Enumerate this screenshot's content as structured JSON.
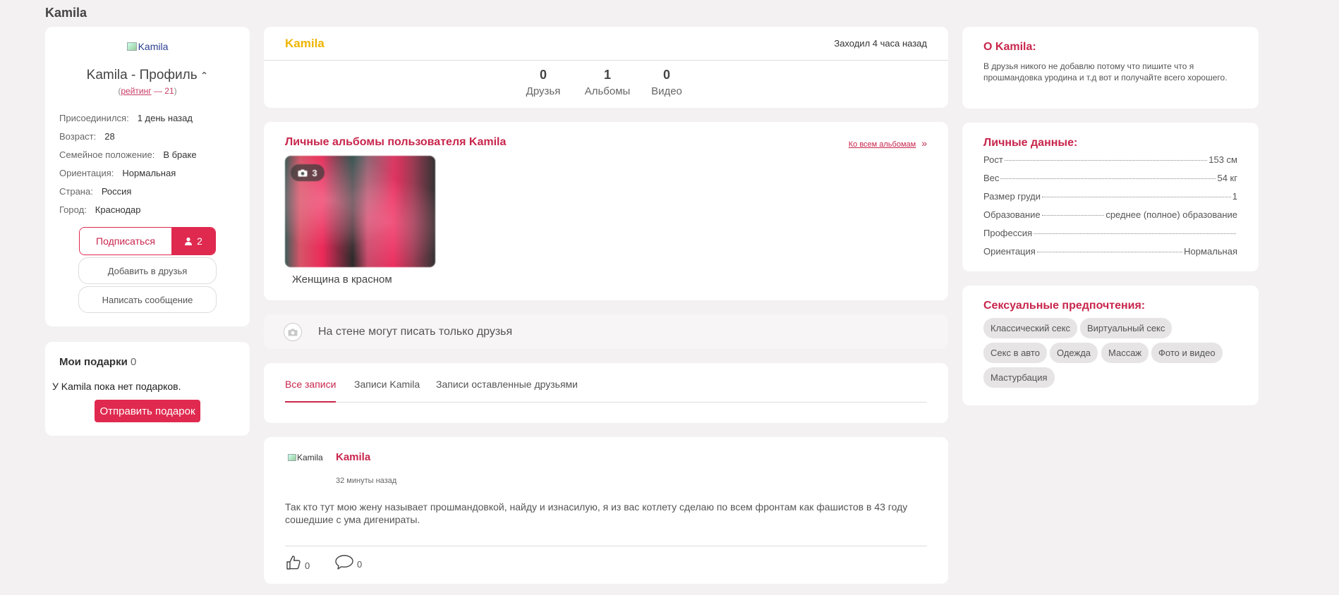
{
  "page": {
    "title": "Kamila"
  },
  "profile": {
    "avatar_alt": "Kamila",
    "name": "Kamila - Профиль",
    "rating_label": "рейтинг",
    "rating_sep": " — ",
    "rating_value": "21",
    "info": [
      {
        "label": "Присоединился:",
        "value": "1 день назад"
      },
      {
        "label": "Возраст:",
        "value": "28"
      },
      {
        "label": "Семейное положение:",
        "value": "В браке"
      },
      {
        "label": "Ориентация:",
        "value": "Нормальная"
      },
      {
        "label": "Страна:",
        "value": "Россия"
      },
      {
        "label": "Город:",
        "value": "Краснодар"
      }
    ],
    "subscribe_label": "Подписаться",
    "subscribers_count": "2",
    "add_friend_label": "Добавить в друзья",
    "message_label": "Написать сообщение"
  },
  "gifts": {
    "title": "Мои подарки",
    "count": "0",
    "empty_text": "У Kamila пока нет подарков.",
    "send_label": "Отправить подарок"
  },
  "header": {
    "brand": "Kamila",
    "last_seen": "Заходил 4 часа назад",
    "stats": [
      {
        "value": "0",
        "label": "Друзья"
      },
      {
        "value": "1",
        "label": "Альбомы"
      },
      {
        "value": "0",
        "label": "Видео"
      }
    ]
  },
  "albums": {
    "title": "Личные альбомы пользователя Kamila",
    "all_link": "Ко всем альбомам",
    "items": [
      {
        "caption": "Женщина в красном",
        "photo_count": "3"
      }
    ]
  },
  "wall": {
    "notice": "На стене могут писать только друзья"
  },
  "tabs": [
    {
      "label": "Все записи",
      "active": true
    },
    {
      "label": "Записи Kamila",
      "active": false
    },
    {
      "label": "Записи оставленные друзьями",
      "active": false
    }
  ],
  "post": {
    "avatar_alt": "Kamila",
    "author": "Kamila",
    "time": "32 минуты назад",
    "text": "Так кто тут мою жену называет прошмандовкой, найду и изнасилую, я из вас котлету сделаю по всем фронтам как фашистов в 43 году сошедшие с ума дигенираты.",
    "likes": "0",
    "comments": "0"
  },
  "about": {
    "title": "О Kamila:",
    "text": "В друзья никого не добавлю потому что пишите что я прошмандовка уродина и т.д вот и получайте всего хорошего."
  },
  "personal": {
    "title": "Личные данные:",
    "rows": [
      {
        "label": "Рост",
        "value": "153 см"
      },
      {
        "label": "Вес",
        "value": "54 кг"
      },
      {
        "label": "Размер груди",
        "value": "1"
      },
      {
        "label": "Образование",
        "value": "среднее (полное) образование"
      },
      {
        "label": "Профессия",
        "value": ""
      },
      {
        "label": "Ориентация",
        "value": "Нормальная"
      }
    ]
  },
  "sexual": {
    "title": "Сексуальные предпочтения:",
    "tags": [
      "Классический секс",
      "Виртуальный секс",
      "Секс в авто",
      "Одежда",
      "Массаж",
      "Фото и видео",
      "Мастурбация"
    ]
  },
  "colors": {
    "accent": "#e0294f",
    "accent_text": "#c8264c",
    "brand": "#f0b400",
    "background": "#f3f1f2"
  },
  "icons": [
    "chevron-up-icon",
    "user-icon",
    "camera-icon",
    "like-icon",
    "comment-icon",
    "double-chevron-right-icon"
  ]
}
